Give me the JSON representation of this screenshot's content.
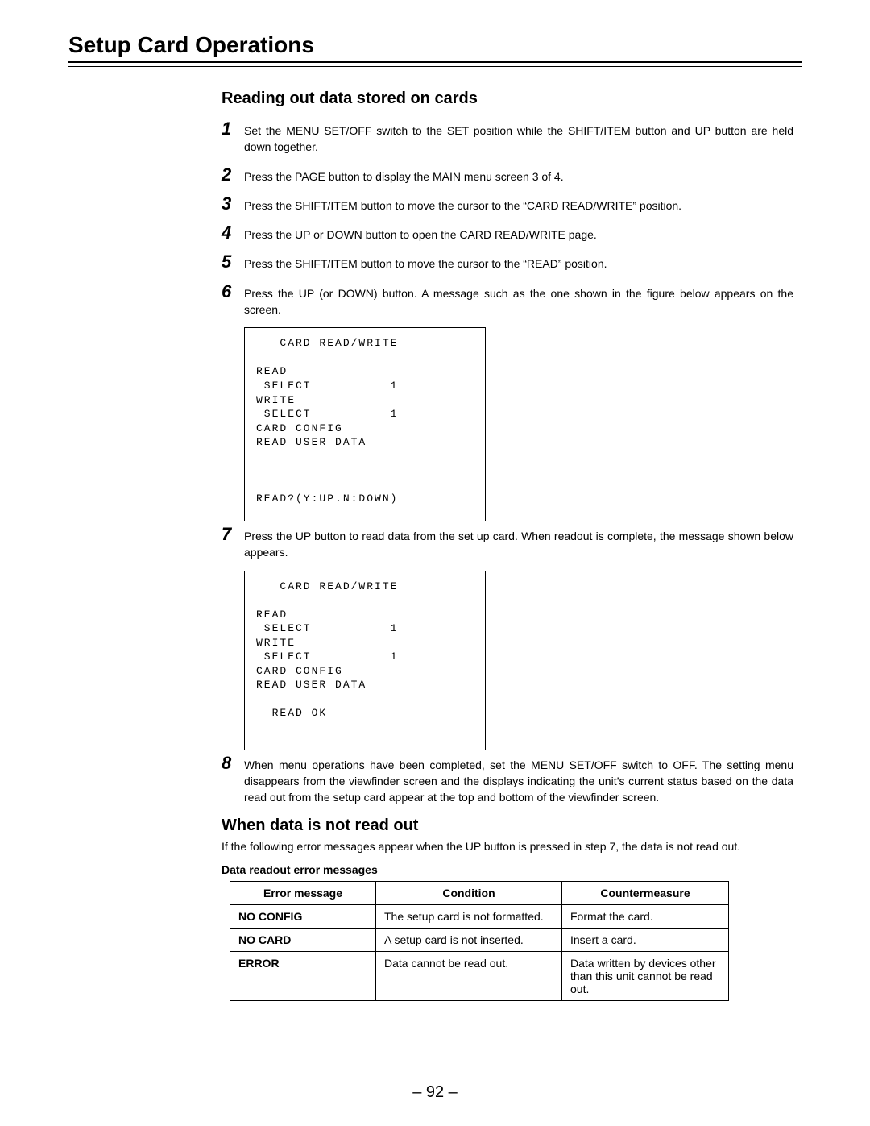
{
  "title": "Setup Card Operations",
  "section": {
    "heading": "Reading out data stored on cards",
    "steps": [
      "Set the MENU SET/OFF switch to the SET position while the SHIFT/ITEM button and UP button are held down together.",
      "Press the PAGE button to display the MAIN menu screen 3 of 4.",
      "Press the SHIFT/ITEM button to move the cursor to the “CARD READ/WRITE” position.",
      "Press the UP or DOWN button to open the CARD READ/WRITE page.",
      "Press the SHIFT/ITEM button to move the cursor to the “READ” position.",
      "Press the UP (or DOWN) button. A message such as the one shown in the figure below appears on the screen.",
      "Press the UP button to read data from the set up card. When readout is complete, the message shown below appears.",
      "When menu operations have been completed, set the MENU SET/OFF switch to OFF. The setting menu disappears from the viewfinder screen and the displays indicating the unit’s current status based on the data read out from the setup card appear at the top and bottom of the viewfinder screen."
    ]
  },
  "screen1": "   CARD READ/WRITE\n\nREAD\n SELECT          1\nWRITE\n SELECT          1\nCARD CONFIG\nREAD USER DATA\n\n\n\nREAD?(Y:UP.N:DOWN)",
  "screen2": "   CARD READ/WRITE\n\nREAD\n SELECT          1\nWRITE\n SELECT          1\nCARD CONFIG\nREAD USER DATA\n\n  READ OK\n\n",
  "subsection": {
    "heading": "When data is not read out",
    "body": "If the following error messages appear when the UP button is pressed in step 7, the data is not read out.",
    "tableTitle": "Data readout error messages"
  },
  "table": {
    "headers": [
      "Error message",
      "Condition",
      "Countermeasure"
    ],
    "rows": [
      {
        "msg": "NO CONFIG",
        "cond": "The setup card is not formatted.",
        "fix": "Format the card."
      },
      {
        "msg": "NO CARD",
        "cond": "A setup card is not inserted.",
        "fix": "Insert a card."
      },
      {
        "msg": "ERROR",
        "cond": "Data cannot be read out.",
        "fix": "Data written by devices other than this unit cannot be read out."
      }
    ]
  },
  "pageNumber": "– 92 –"
}
